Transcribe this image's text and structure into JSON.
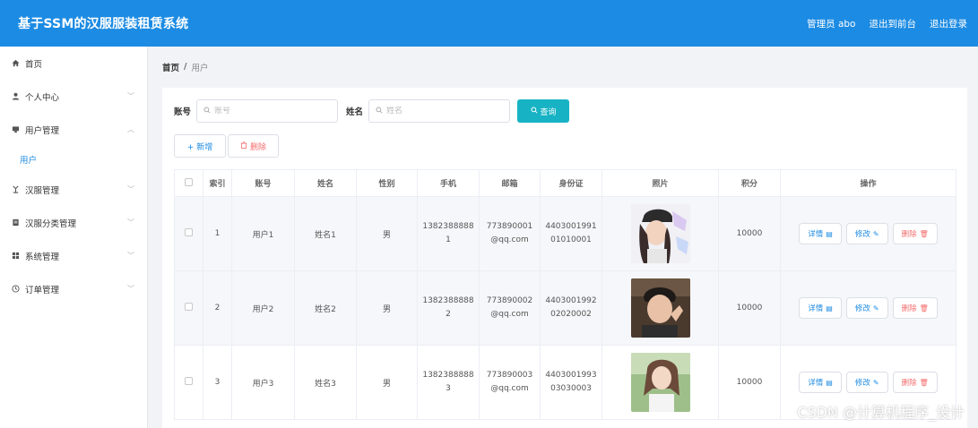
{
  "header": {
    "title": "基于SSM的汉服服装租赁系统",
    "user_label": "管理员 abo",
    "front_link": "退出到前台",
    "logout_link": "退出登录"
  },
  "sidebar": {
    "items": [
      {
        "label": "首页",
        "icon": "home-icon"
      },
      {
        "label": "个人中心",
        "icon": "user-icon"
      },
      {
        "label": "用户管理",
        "icon": "user-manage-icon"
      },
      {
        "label": "用户",
        "icon": ""
      },
      {
        "label": "汉服管理",
        "icon": "hanfu-icon"
      },
      {
        "label": "汉服分类管理",
        "icon": "category-icon"
      },
      {
        "label": "系统管理",
        "icon": "grid-icon"
      },
      {
        "label": "订单管理",
        "icon": "order-icon"
      }
    ]
  },
  "breadcrumb": {
    "home": "首页",
    "separator": "/",
    "current": "用户"
  },
  "search": {
    "account_label": "账号",
    "account_placeholder": "账号",
    "name_label": "姓名",
    "name_placeholder": "姓名",
    "query_label": "查询"
  },
  "actions": {
    "add_label": "+ 新增",
    "delete_label": "删除"
  },
  "table": {
    "columns": [
      "索引",
      "账号",
      "姓名",
      "性别",
      "手机",
      "邮箱",
      "身份证",
      "照片",
      "积分",
      "操作"
    ],
    "rows": [
      {
        "index": "1",
        "account": "用户1",
        "name": "姓名1",
        "gender": "男",
        "phone": "13823888881",
        "phone_a": "1382388888",
        "phone_b": "1",
        "email_a": "773890001",
        "email_b": "@qq.com",
        "id_a": "4403001991",
        "id_b": "01010001",
        "points": "10000"
      },
      {
        "index": "2",
        "account": "用户2",
        "name": "姓名2",
        "gender": "男",
        "phone": "13823888882",
        "phone_a": "1382388888",
        "phone_b": "2",
        "email_a": "773890002",
        "email_b": "@qq.com",
        "id_a": "4403001992",
        "id_b": "02020002",
        "points": "10000"
      },
      {
        "index": "3",
        "account": "用户3",
        "name": "姓名3",
        "gender": "男",
        "phone": "13823888883",
        "phone_a": "1382388888",
        "phone_b": "3",
        "email_a": "773890003",
        "email_b": "@qq.com",
        "id_a": "4403001993",
        "id_b": "03030003",
        "points": "10000"
      }
    ],
    "op_detail": "详情",
    "op_edit": "修改",
    "op_delete": "删除"
  },
  "watermark": "CSDN @计算机程序_设计",
  "colors": {
    "primary": "#1c8be3",
    "query": "#17b3c4",
    "danger": "#f56c6c"
  }
}
